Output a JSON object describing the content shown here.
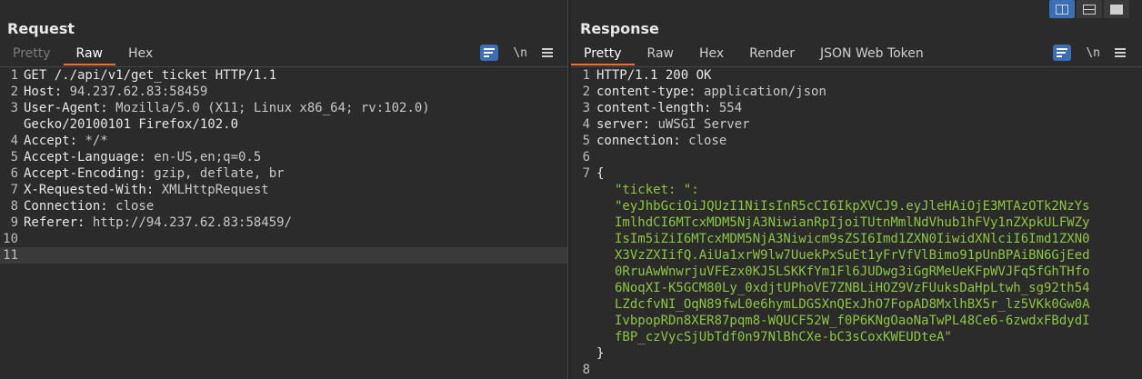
{
  "request": {
    "title": "Request",
    "tabs": [
      "Pretty",
      "Raw",
      "Hex"
    ],
    "active_tab": "Raw",
    "newline_toggle": "\\n",
    "lines": [
      {
        "n": "1",
        "text": "GET /./api/v1/get_ticket HTTP/1.1"
      },
      {
        "n": "2",
        "name": "Host:",
        "value": " 94.237.62.83:58459"
      },
      {
        "n": "3",
        "name": "User-Agent:",
        "value": " Mozilla/5.0 (X11; Linux x86_64; rv:102.0)"
      },
      {
        "n": "",
        "text": "Gecko/20100101 Firefox/102.0"
      },
      {
        "n": "4",
        "name": "Accept:",
        "value": " */*"
      },
      {
        "n": "5",
        "name": "Accept-Language:",
        "value": " en-US,en;q=0.5"
      },
      {
        "n": "6",
        "name": "Accept-Encoding:",
        "value": " gzip, deflate, br"
      },
      {
        "n": "7",
        "name": "X-Requested-With:",
        "value": " XMLHttpRequest"
      },
      {
        "n": "8",
        "name": "Connection:",
        "value": " close"
      },
      {
        "n": "9",
        "name": "Referer:",
        "value": " http://94.237.62.83:58459/"
      },
      {
        "n": "10",
        "text": ""
      },
      {
        "n": "11",
        "text": ""
      }
    ]
  },
  "response": {
    "title": "Response",
    "tabs": [
      "Pretty",
      "Raw",
      "Hex",
      "Render",
      "JSON Web Token"
    ],
    "active_tab": "Pretty",
    "newline_toggle": "\\n",
    "lines": [
      {
        "n": "1",
        "text": "HTTP/1.1 200 OK"
      },
      {
        "n": "2",
        "name": "content-type:",
        "value": " application/json"
      },
      {
        "n": "3",
        "name": "content-length:",
        "value": " 554"
      },
      {
        "n": "4",
        "name": "server:",
        "value": " uWSGI Server"
      },
      {
        "n": "5",
        "name": "connection:",
        "value": " close"
      },
      {
        "n": "6",
        "text": ""
      },
      {
        "n": "7",
        "text": "{"
      }
    ],
    "json_key": "\"ticket: \":",
    "json_value_lines": [
      "\"eyJhbGciOiJQUzI1NiIsInR5cCI6IkpXVCJ9.eyJleHAiOjE3MTAzOTk2NzYs",
      "ImlhdCI6MTcxMDM5NjA3NiwianRpIjoiTUtnMmlNdVhub1hFVy1nZXpkULFWZy",
      "IsIm5iZiI6MTcxMDM5NjA3Niwicm9sZSI6Imd1ZXN0IiwidXNlciI6Imd1ZXN0",
      "X3VzZXIifQ.AiUa1xrW9lw7UuekPxSuEt1yFrVfVlBimo91pUnBPAiBN6GjEed",
      "0RruAwWnwrjuVFEzx0KJ5LSKKfYm1Fl6JUDwg3iGgRMeUeKFpWVJFq5fGhTHfo",
      "6NoqXI-K5GCM80Ly_0xdjtUPhoVE7ZNBLiHOZ9VzFUuksDaHpLtwh_sg92th54",
      "LZdcfvNI_OqN89fwL0e6hymLDGSXnQExJhO7FopAD8MxlhBX5r_lz5VKk0Gw0A",
      "IvbpopRDn8XER87pqm8-WQUCF52W_f0P6KNgOaoNaTwPL48Ce6-6zwdxFBdydI",
      "fBP_czVycSjUbTdf0n97NlBhCXe-bC3sCoxKWEUDteA\""
    ],
    "closing_brace": "}",
    "last_line_number": "8"
  }
}
